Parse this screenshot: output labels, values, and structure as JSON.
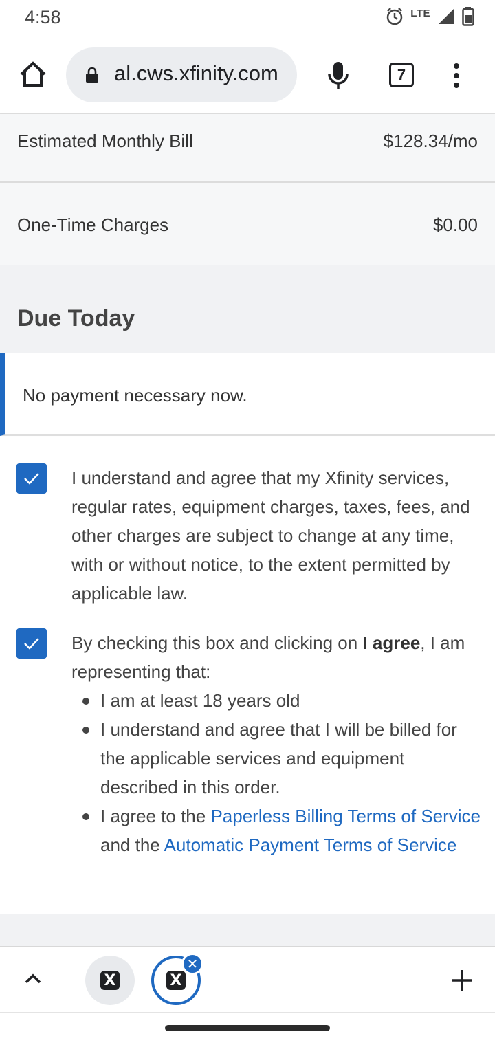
{
  "status_bar": {
    "time": "4:58",
    "network": "LTE"
  },
  "browser": {
    "url": "al.cws.xfinity.com",
    "tab_count": "7"
  },
  "summary": {
    "monthly_label": "Estimated Monthly Bill",
    "monthly_value": "$128.34/mo",
    "onetime_label": "One-Time Charges",
    "onetime_value": "$0.00"
  },
  "due_today": {
    "title": "Due Today",
    "notice": "No payment necessary now."
  },
  "agreements": {
    "terms_1": "I understand and agree that my Xfinity services, regular rates, equipment charges, taxes, fees, and other charges are subject to change at any time, with or without notice, to the extent permitted by applicable law.",
    "terms_2_prefix": "By checking this box and clicking on ",
    "terms_2_bold": "I agree",
    "terms_2_suffix": ", I am representing that:",
    "bullet_1": "I am at least 18 years old",
    "bullet_2": "I understand and agree that I will be billed for the applicable services and equipment described in this order.",
    "bullet_3_prefix": "I agree to the ",
    "bullet_3_link1": "Paperless Billing Terms of Service",
    "bullet_3_middle": " and the ",
    "bullet_3_link2": "Automatic Payment Terms of Service"
  },
  "bottom_tabs": {
    "tab1_letter": "X",
    "tab2_letter": "X"
  },
  "colors": {
    "accent": "#1f69c1"
  }
}
